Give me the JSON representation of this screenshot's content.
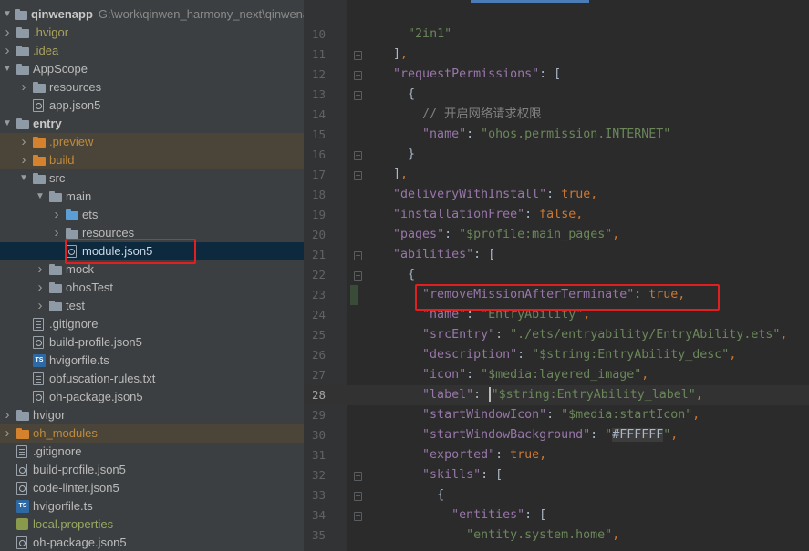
{
  "project": {
    "name": "qinwenapp",
    "path": "G:\\work\\qinwen_harmony_next\\qinwena",
    "tree": [
      {
        "label": ".hvigor",
        "depth": 1,
        "kind": "folder",
        "expanded": false
      },
      {
        "label": ".idea",
        "depth": 1,
        "kind": "folder",
        "expanded": false
      },
      {
        "label": "AppScope",
        "depth": 1,
        "kind": "folder",
        "expanded": true
      },
      {
        "label": "resources",
        "depth": 2,
        "kind": "folder",
        "expanded": false
      },
      {
        "label": "app.json5",
        "depth": 2,
        "kind": "json"
      },
      {
        "label": "entry",
        "depth": 1,
        "kind": "module",
        "expanded": true
      },
      {
        "label": ".preview",
        "depth": 2,
        "kind": "folder",
        "expanded": false
      },
      {
        "label": "build",
        "depth": 2,
        "kind": "folder",
        "expanded": false
      },
      {
        "label": "src",
        "depth": 2,
        "kind": "folder",
        "expanded": true
      },
      {
        "label": "main",
        "depth": 3,
        "kind": "folder",
        "expanded": true
      },
      {
        "label": "ets",
        "depth": 4,
        "kind": "folder",
        "expanded": false
      },
      {
        "label": "resources",
        "depth": 4,
        "kind": "folder",
        "expanded": false
      },
      {
        "label": "module.json5",
        "depth": 4,
        "kind": "json",
        "selected": true
      },
      {
        "label": "mock",
        "depth": 3,
        "kind": "folder",
        "expanded": false
      },
      {
        "label": "ohosTest",
        "depth": 3,
        "kind": "folder",
        "expanded": false
      },
      {
        "label": "test",
        "depth": 3,
        "kind": "folder",
        "expanded": false
      },
      {
        "label": ".gitignore",
        "depth": 2,
        "kind": "file"
      },
      {
        "label": "build-profile.json5",
        "depth": 2,
        "kind": "json"
      },
      {
        "label": "hvigorfile.ts",
        "depth": 2,
        "kind": "ts"
      },
      {
        "label": "obfuscation-rules.txt",
        "depth": 2,
        "kind": "file"
      },
      {
        "label": "oh-package.json5",
        "depth": 2,
        "kind": "json"
      },
      {
        "label": "hvigor",
        "depth": 1,
        "kind": "folder",
        "expanded": false
      },
      {
        "label": "oh_modules",
        "depth": 1,
        "kind": "folder",
        "expanded": false
      },
      {
        "label": ".gitignore",
        "depth": 1,
        "kind": "file"
      },
      {
        "label": "build-profile.json5",
        "depth": 1,
        "kind": "json"
      },
      {
        "label": "code-linter.json5",
        "depth": 1,
        "kind": "json"
      },
      {
        "label": "hvigorfile.ts",
        "depth": 1,
        "kind": "ts"
      },
      {
        "label": "local.properties",
        "depth": 1,
        "kind": "props"
      },
      {
        "label": "oh-package.json5",
        "depth": 1,
        "kind": "json"
      }
    ]
  },
  "editor": {
    "current_line": "28",
    "lines": [
      {
        "n": "10",
        "t": "      \"2in1\""
      },
      {
        "n": "11",
        "t": "    ],"
      },
      {
        "n": "12",
        "t": "    \"requestPermissions\": ["
      },
      {
        "n": "13",
        "t": "      {"
      },
      {
        "n": "14",
        "t": "        // 开启网络请求权限"
      },
      {
        "n": "15",
        "t": "        \"name\": \"ohos.permission.INTERNET\""
      },
      {
        "n": "16",
        "t": "      }"
      },
      {
        "n": "17",
        "t": "    ],"
      },
      {
        "n": "18",
        "t": "    \"deliveryWithInstall\": true,"
      },
      {
        "n": "19",
        "t": "    \"installationFree\": false,"
      },
      {
        "n": "20",
        "t": "    \"pages\": \"$profile:main_pages\","
      },
      {
        "n": "21",
        "t": "    \"abilities\": ["
      },
      {
        "n": "22",
        "t": "      {"
      },
      {
        "n": "23",
        "t": "        \"removeMissionAfterTerminate\": true,"
      },
      {
        "n": "24",
        "t": "        \"name\": \"EntryAbility\","
      },
      {
        "n": "25",
        "t": "        \"srcEntry\": \"./ets/entryability/EntryAbility.ets\","
      },
      {
        "n": "26",
        "t": "        \"description\": \"$string:EntryAbility_desc\","
      },
      {
        "n": "27",
        "t": "        \"icon\": \"$media:layered_image\","
      },
      {
        "n": "28",
        "t": "        \"label\": \"$string:EntryAbility_label\","
      },
      {
        "n": "29",
        "t": "        \"startWindowIcon\": \"$media:startIcon\","
      },
      {
        "n": "30",
        "t": "        \"startWindowBackground\": \"#FFFFFF\","
      },
      {
        "n": "31",
        "t": "        \"exported\": true,"
      },
      {
        "n": "32",
        "t": "        \"skills\": ["
      },
      {
        "n": "33",
        "t": "          {"
      },
      {
        "n": "34",
        "t": "            \"entities\": ["
      },
      {
        "n": "35",
        "t": "              \"entity.system.home\","
      }
    ]
  },
  "colors": {
    "key": "#9876aa",
    "string": "#6a8759",
    "keyword": "#cc7832",
    "comment": "#808080",
    "annotation": "#e02020"
  }
}
